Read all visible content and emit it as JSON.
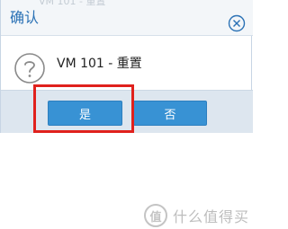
{
  "dialog": {
    "title": "确认",
    "background_text": "VM 101 - 重置",
    "message": "VM 101 - 重置",
    "close_icon": "close-circle-icon",
    "question_icon": "question-circle-icon"
  },
  "buttons": {
    "yes_label": "是",
    "no_label": "否"
  },
  "watermark": {
    "icon_text": "值",
    "text": "什么值得买"
  },
  "colors": {
    "title": "#2a71b5",
    "button": "#3892d4",
    "footer": "#dde6ef",
    "highlight": "#e0211d"
  }
}
